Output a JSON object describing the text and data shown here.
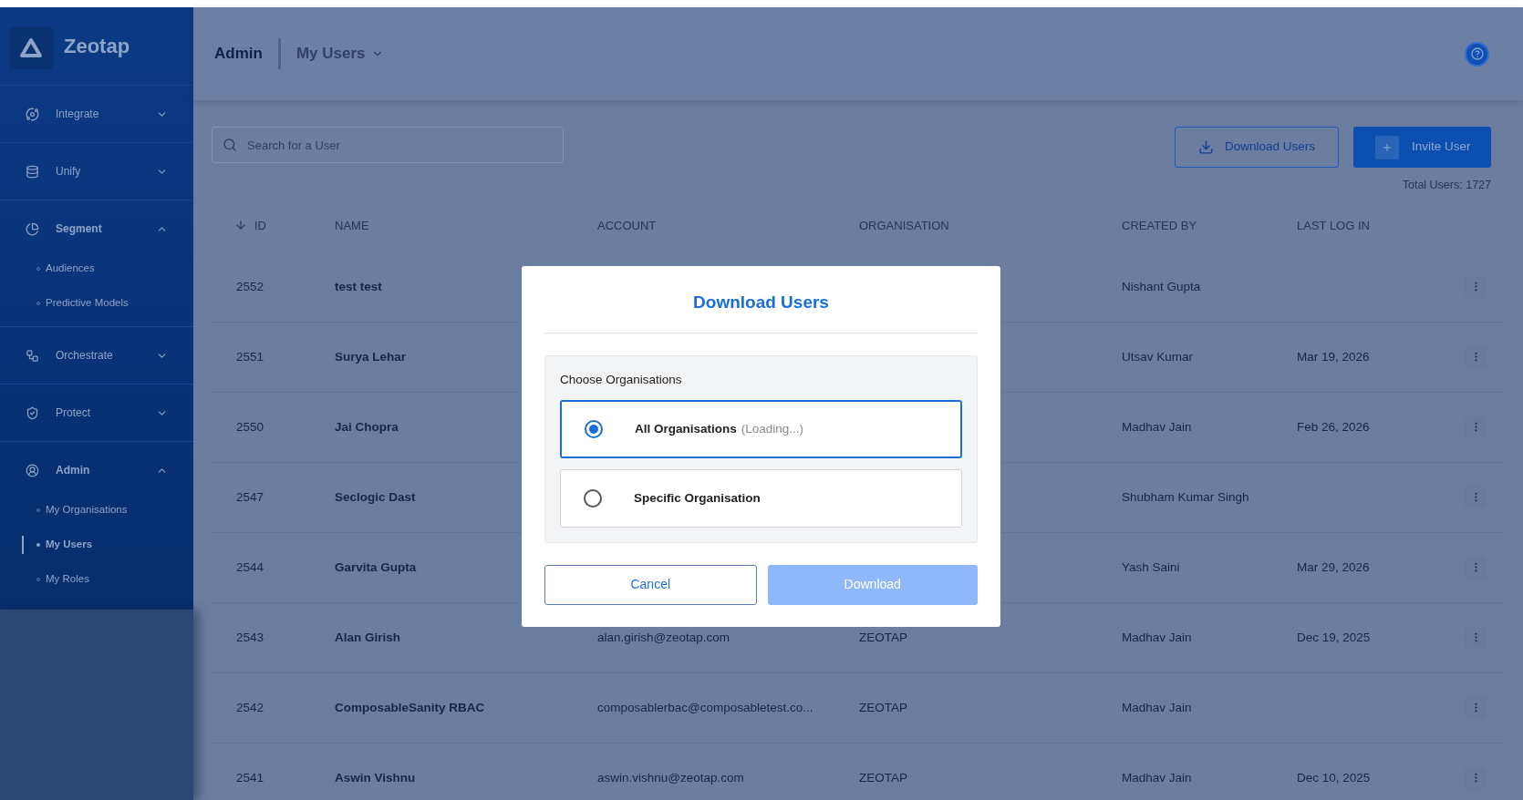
{
  "sidebar": {
    "brand": "Zeotap",
    "items": [
      {
        "label": "Integrate",
        "expanded": false
      },
      {
        "label": "Unify",
        "expanded": false
      },
      {
        "label": "Segment",
        "expanded": true,
        "children": [
          {
            "label": "Audiences",
            "selected": false
          },
          {
            "label": "Predictive Models",
            "selected": false
          }
        ]
      },
      {
        "label": "Orchestrate",
        "expanded": false
      },
      {
        "label": "Protect",
        "expanded": false
      },
      {
        "label": "Admin",
        "expanded": true,
        "children": [
          {
            "label": "My Organisations",
            "selected": false
          },
          {
            "label": "My Users",
            "selected": true
          },
          {
            "label": "My Roles",
            "selected": false
          }
        ]
      }
    ]
  },
  "header": {
    "section": "Admin",
    "page": "My Users"
  },
  "search": {
    "placeholder": "Search for a User"
  },
  "actions": [
    {
      "kind": "outline",
      "label": "Download Users"
    },
    {
      "kind": "primary",
      "label": "Invite User"
    }
  ],
  "total": "Total Users: 1727",
  "table": {
    "columns": [
      {
        "label": "ID",
        "sorted": true
      },
      {
        "label": "NAME",
        "sorted": false
      },
      {
        "label": "ACCOUNT",
        "sorted": false
      },
      {
        "label": "ORGANISATION",
        "sorted": false
      },
      {
        "label": "CREATED BY",
        "sorted": false
      },
      {
        "label": "LAST LOG IN",
        "sorted": false
      }
    ],
    "rows": [
      {
        "id": "2552",
        "name": "test test",
        "created_by": "Nishant Gupta"
      },
      {
        "id": "2551",
        "name": "Surya Lehar",
        "created_by": "Utsav Kumar",
        "last_log_in": "Mar 19, 2026"
      },
      {
        "id": "2550",
        "name": "Jai Chopra",
        "created_by": "Madhav Jain",
        "last_log_in": "Feb 26, 2026"
      },
      {
        "id": "2547",
        "name": "Seclogic Dast",
        "created_by": "Shubham Kumar Singh"
      },
      {
        "id": "2544",
        "name": "Garvita Gupta",
        "created_by": "Yash Saini",
        "last_log_in": "Mar 29, 2026"
      },
      {
        "id": "2543",
        "name": "Alan Girish",
        "account": "alan.girish@zeotap.com",
        "organisation": "ZEOTAP",
        "created_by": "Madhav Jain",
        "last_log_in": "Dec 19, 2025"
      },
      {
        "id": "2542",
        "name": "ComposableSanity RBAC",
        "account": "composablerbac@composabletest.co...",
        "organisation": "ZEOTAP",
        "created_by": "Madhav Jain"
      },
      {
        "id": "2541",
        "name": "Aswin Vishnu",
        "account": "aswin.vishnu@zeotap.com",
        "organisation": "ZEOTAP",
        "created_by": "Madhav Jain",
        "last_log_in": "Dec 10, 2025"
      }
    ]
  },
  "dialog": {
    "title": "Download Users",
    "label": "Choose Organisations",
    "options": [
      {
        "label": "All Organisations",
        "note": "(Loading...)",
        "selected": true
      },
      {
        "label": "Specific Organisation",
        "selected": false
      }
    ],
    "buttons": [
      {
        "kind": "secondary",
        "label": "Cancel",
        "disabled": false
      },
      {
        "kind": "primary",
        "label": "Download",
        "disabled": true
      }
    ]
  }
}
